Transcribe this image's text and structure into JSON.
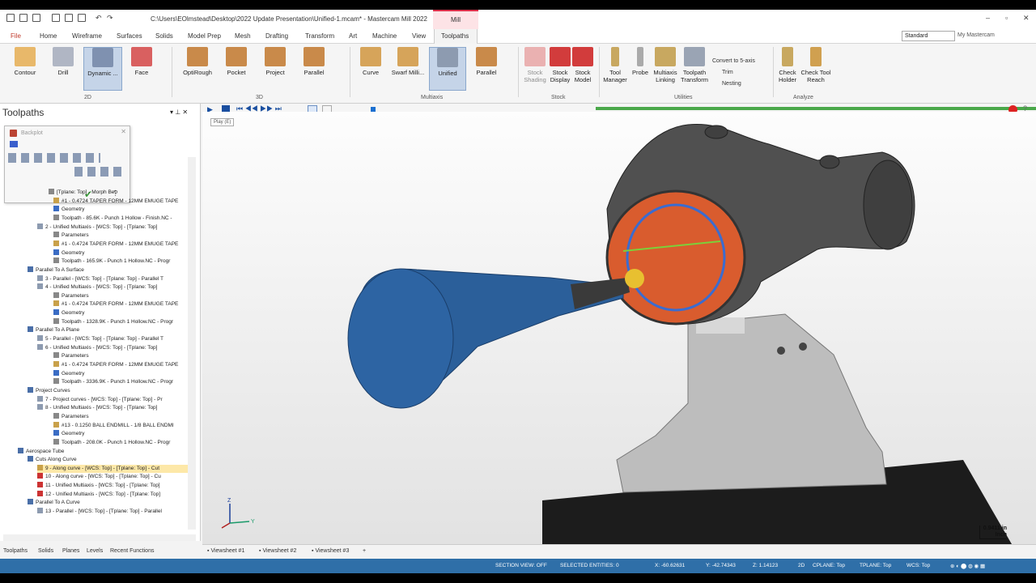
{
  "titlebar": {
    "path": "C:\\Users\\EOlmstead\\Desktop\\2022 Update Presentation\\Unified-1.mcam* - Mastercam Mill 2022",
    "context": "Mill"
  },
  "menu": {
    "tabs": [
      "File",
      "Home",
      "Wireframe",
      "Surfaces",
      "Solids",
      "Model Prep",
      "Mesh",
      "Drafting",
      "Transform",
      "Art",
      "Machine",
      "View",
      "Toolpaths"
    ],
    "config": "Standard",
    "my_mastercam": "My Mastercam"
  },
  "ribbon": {
    "buttons": [
      "Contour",
      "Drill",
      "Dynamic ...",
      "Face",
      "OptiRough",
      "Pocket",
      "Project",
      "Parallel",
      "Curve",
      "Swarf Milli...",
      "Unified",
      "Parallel",
      "Stock Shading",
      "Stock Display",
      "Stock Model",
      "Tool Manager",
      "Probe",
      "Multiaxis Linking",
      "Toolpath Transform",
      "Check Holder",
      "Check Tool Reach"
    ],
    "utilities_small": [
      "Convert to 5-axis",
      "Trim",
      "Nesting"
    ],
    "groups": [
      "2D",
      "3D",
      "Multiaxis",
      "Stock",
      "Utilities",
      "Analyze"
    ]
  },
  "panel": {
    "title": "Toolpaths",
    "backplot_title": "Backplot",
    "tree": [
      "[Tplane: Top] - Morph Bet",
      "#1 - 0.4724 TAPER FORM - 12MM EMUGE TAPE",
      "Geometry",
      "Toolpath - 85.6K - Punch 1 Hollow - Finish.NC -",
      "2 - Unified Multiaxis - [WCS: Top] - [Tplane: Top]",
      "Parameters",
      "#1 - 0.4724 TAPER FORM - 12MM EMUGE TAPE",
      "Geometry",
      "Toolpath - 165.9K - Punch 1 Hollow.NC - Progr",
      "Parallel To A Surface",
      "3 - Parallel - [WCS: Top] - [Tplane: Top] - Parallel T",
      "4 - Unified Multiaxis - [WCS: Top] - [Tplane: Top]",
      "Parameters",
      "#1 - 0.4724 TAPER FORM - 12MM EMUGE TAPE",
      "Geometry",
      "Toolpath - 1328.9K - Punch 1 Hollow.NC - Progr",
      "Parallel To A Plane",
      "5 - Parallel - [WCS: Top] - [Tplane: Top] - Parallel T",
      "6 - Unified Multiaxis - [WCS: Top] - [Tplane: Top]",
      "Parameters",
      "#1 - 0.4724 TAPER FORM - 12MM EMUGE TAPE",
      "Geometry",
      "Toolpath - 3336.9K - Punch 1 Hollow.NC - Progr",
      "Project Curves",
      "7 - Project curves - [WCS: Top] - [Tplane: Top] - Pr",
      "8 - Unified Multiaxis - [WCS: Top] - [Tplane: Top]",
      "Parameters",
      "#13 - 0.1250 BALL ENDMILL - 1/8 BALL ENDMI",
      "Geometry",
      "Toolpath - 208.0K - Punch 1 Hollow.NC - Progr",
      "Aerospace Tube",
      "Cuts Along Curve",
      "9 - Along curve - [WCS: Top] - [Tplane: Top] - Cut",
      "10 - Along curve - [WCS: Top] - [Tplane: Top] - Cu",
      "11 - Unified Multiaxis - [WCS: Top] - [Tplane: Top]",
      "12 - Unified Multiaxis - [WCS: Top] - [Tplane: Top]",
      "Parallel To A Curve",
      "13 - Parallel - [WCS: Top] - [Tplane: Top] - Parallel"
    ],
    "tabs": [
      "Toolpaths",
      "Solids",
      "Planes",
      "Levels",
      "Recent Functions"
    ]
  },
  "viewport": {
    "play_tip": "Play (E)",
    "scale_value": "0.9411 in",
    "scale_unit": "Inch",
    "progress_fraction": 1.0,
    "colors": {
      "tool": "#2b5f9a",
      "part": "#e06a3a",
      "body": "#4a4a4a",
      "fixture": "#c8c8c8"
    }
  },
  "viewsheets": [
    "Viewsheet #1",
    "Viewsheet #2",
    "Viewsheet #3"
  ],
  "status": {
    "section_view": "SECTION VIEW: OFF",
    "selected": "SELECTED ENTITIES: 0",
    "x": "X: -60.62631",
    "y": "Y: -42.74343",
    "z": "Z: 1.14123",
    "mode": "2D",
    "cplane": "CPLANE: Top",
    "tplane": "TPLANE: Top",
    "wcs": "WCS: Top"
  }
}
